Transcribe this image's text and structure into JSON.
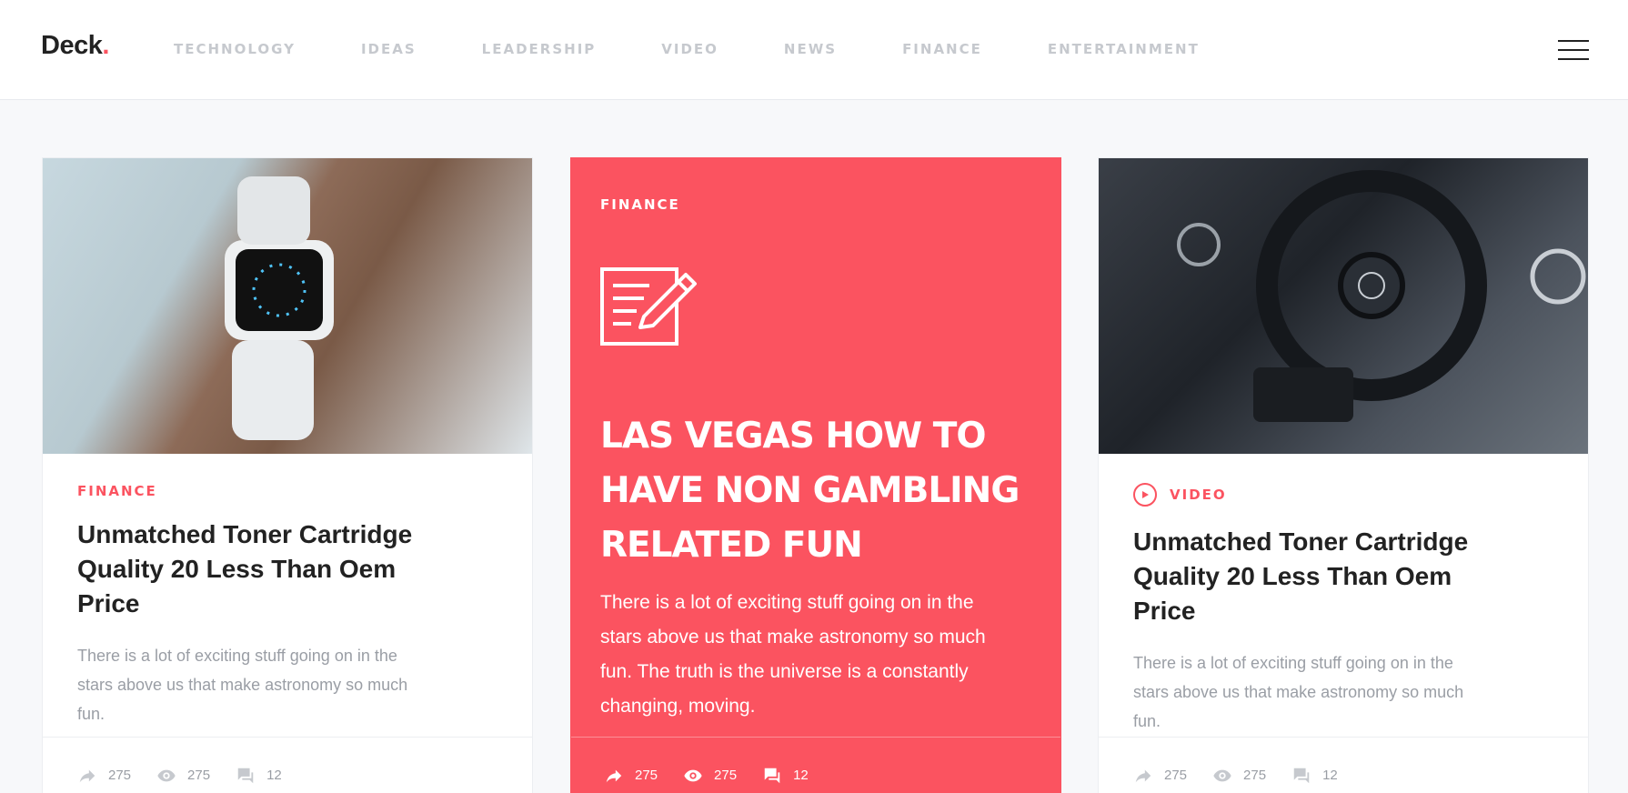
{
  "header": {
    "logo_text": "Deck",
    "logo_dot": ".",
    "nav": [
      "TECHNOLOGY",
      "IDEAS",
      "LEADERSHIP",
      "VIDEO",
      "NEWS",
      "FINANCE",
      "ENTERTAINMENT"
    ]
  },
  "cards": [
    {
      "category": "FINANCE",
      "title": "Unmatched Toner Cartridge Quality 20 Less Than Oem Price",
      "excerpt": "There is a lot of exciting stuff going on in the stars above us that make astronomy so much fun.",
      "shares": "275",
      "views": "275",
      "comments": "12"
    },
    {
      "category": "FINANCE",
      "title": "LAS VEGAS HOW TO HAVE NON GAMBLING RELATED FUN",
      "excerpt": "There is a lot of exciting stuff going on in the stars above us that make astronomy so much fun. The truth is the universe is a constantly changing, moving.",
      "shares": "275",
      "views": "275",
      "comments": "12"
    },
    {
      "category": "VIDEO",
      "title": "Unmatched Toner Cartridge Quality 20 Less Than Oem Price",
      "excerpt": "There is a lot of exciting stuff going on in the stars above us that make astronomy so much fun.",
      "shares": "275",
      "views": "275",
      "comments": "12"
    }
  ],
  "colors": {
    "accent": "#fb5360",
    "text_dark": "#222222",
    "text_muted": "#9a9ea5",
    "nav_muted": "#c6c9ce"
  },
  "icons": [
    "hamburger-menu-icon",
    "share-icon",
    "eye-icon",
    "comment-icon",
    "play-icon",
    "edit-document-icon"
  ]
}
